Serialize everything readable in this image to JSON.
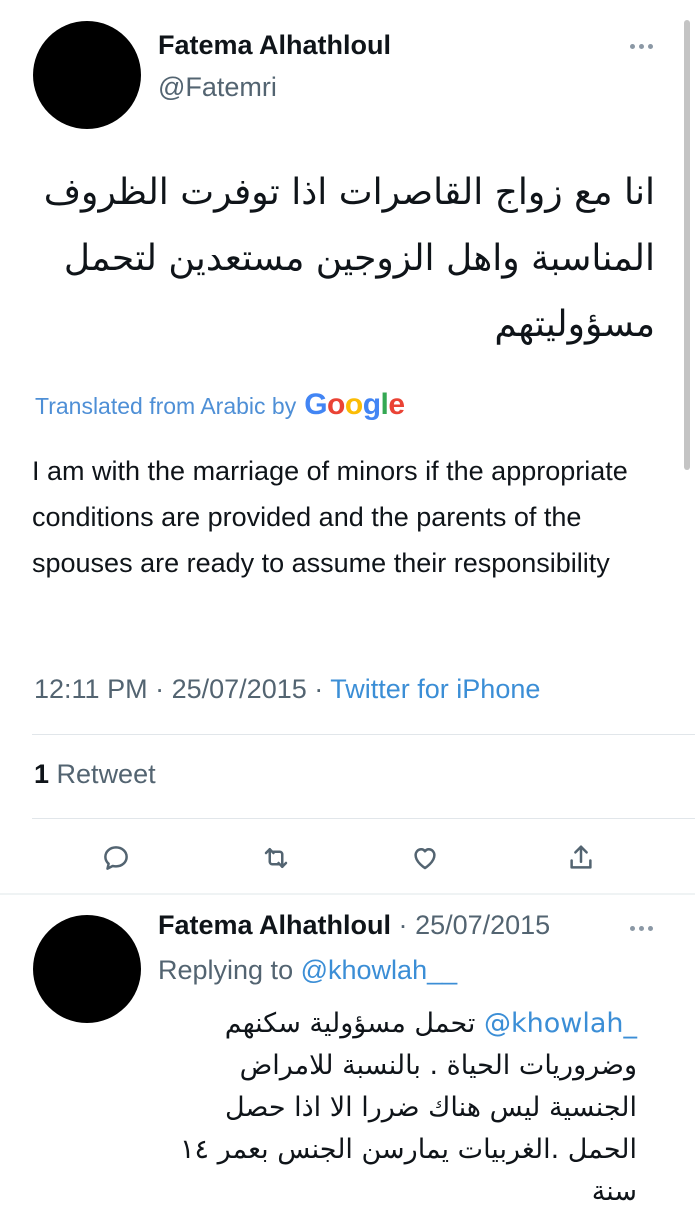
{
  "tweet": {
    "author_name": "Fatema Alhathloul",
    "author_handle": "@Fatemri",
    "text_arabic": "انا مع زواج القاصرات اذا توفرت الظروف المناسبة واهل الزوجين مستعدين لتحمل مسؤوليتهم",
    "translated_label": "Translated from Arabic by",
    "google_logo": {
      "letters": [
        "G",
        "o",
        "o",
        "g",
        "l",
        "e"
      ],
      "colors": [
        "#4285f4",
        "#ea4335",
        "#fbbc05",
        "#4285f4",
        "#34a853",
        "#ea4335"
      ]
    },
    "translation": "I am with the marriage of minors if the appropriate conditions are provided and the parents of the spouses are ready to assume their responsibility",
    "time": "12:11 PM",
    "separator": "·",
    "date": "25/07/2015",
    "source": "Twitter for iPhone",
    "retweet_count": "1",
    "retweet_label": "Retweet"
  },
  "actions": [
    {
      "name": "reply-icon"
    },
    {
      "name": "retweet-icon"
    },
    {
      "name": "like-icon"
    },
    {
      "name": "share-icon"
    }
  ],
  "reply": {
    "author_name": "Fatema Alhathloul",
    "separator": "·",
    "date": "25/07/2015",
    "replying_label": "Replying to",
    "replying_to": "@khowlah__",
    "mention": "@khowlah_",
    "text_arabic": "تحمل مسؤولية سكنهم وضروريات الحياة . بالنسبة للامراض الجنسية ليس هناك ضررا الا اذا حصل الحمل .الغربيات يمارسن الجنس بعمر ١٤ سنة"
  },
  "colors": {
    "link": "#3b8ed6",
    "secondary_text": "#536471",
    "primary_text": "#0f1419"
  }
}
